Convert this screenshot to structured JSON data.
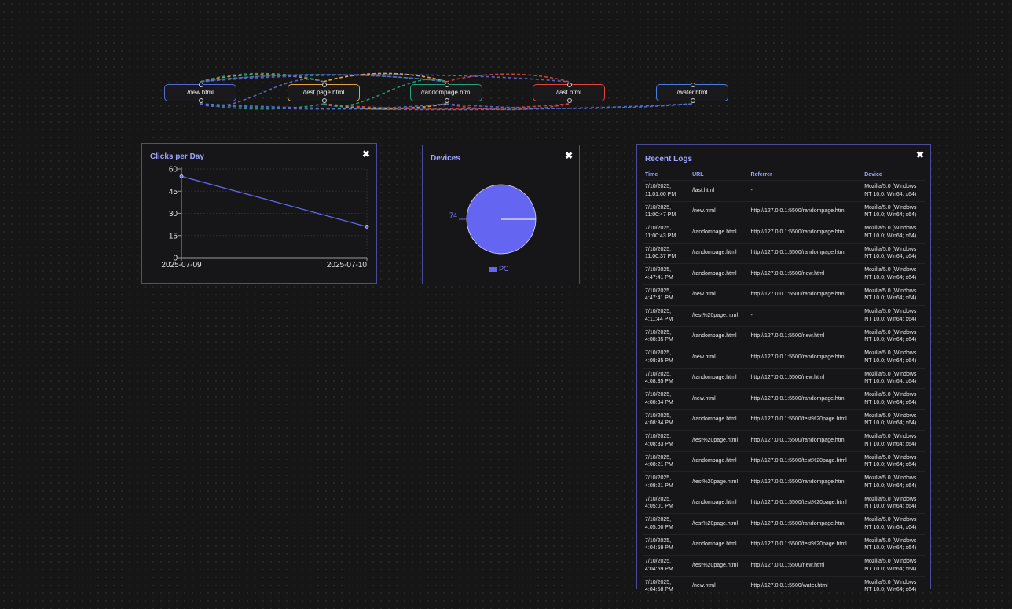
{
  "nodes": [
    {
      "label": "/new.html",
      "border": "#5a6ad6"
    },
    {
      "label": "/test page.html",
      "border": "#e0a345"
    },
    {
      "label": "/randompage.html",
      "border": "#27a07a"
    },
    {
      "label": "/last.html",
      "border": "#e0463d"
    },
    {
      "label": "/water.html",
      "border": "#4a7ee0"
    }
  ],
  "clicks_panel": {
    "title": "Clicks per Day",
    "close": "✖"
  },
  "devices_panel": {
    "title": "Devices",
    "close": "✖",
    "legend": "PC"
  },
  "logs_panel": {
    "title": "Recent Logs",
    "close": "✖",
    "headers": [
      "Time",
      "URL",
      "Referrer",
      "Device"
    ],
    "rows": [
      {
        "time": "7/10/2025, 11:01:00 PM",
        "url": "/last.html",
        "referrer": "-",
        "device": "Mozilla/5.0 (Windows NT 10.0; Win64; x64)"
      },
      {
        "time": "7/10/2025, 11:00:47 PM",
        "url": "/new.html",
        "referrer": "http://127.0.0.1:5500/randompage.html",
        "device": "Mozilla/5.0 (Windows NT 10.0; Win64; x64)"
      },
      {
        "time": "7/10/2025, 11:00:43 PM",
        "url": "/randompage.html",
        "referrer": "http://127.0.0.1:5500/randompage.html",
        "device": "Mozilla/5.0 (Windows NT 10.0; Win64; x64)"
      },
      {
        "time": "7/10/2025, 11:00:37 PM",
        "url": "/randompage.html",
        "referrer": "http://127.0.0.1:5500/randompage.html",
        "device": "Mozilla/5.0 (Windows NT 10.0; Win64; x64)"
      },
      {
        "time": "7/10/2025, 4:47:41 PM",
        "url": "/randompage.html",
        "referrer": "http://127.0.0.1:5500/new.html",
        "device": "Mozilla/5.0 (Windows NT 10.0; Win64; x64)"
      },
      {
        "time": "7/10/2025, 4:47:41 PM",
        "url": "/new.html",
        "referrer": "http://127.0.0.1:5500/randompage.html",
        "device": "Mozilla/5.0 (Windows NT 10.0; Win64; x64)"
      },
      {
        "time": "7/10/2025, 4:11:44 PM",
        "url": "/test%20page.html",
        "referrer": "-",
        "device": "Mozilla/5.0 (Windows NT 10.0; Win64; x64)"
      },
      {
        "time": "7/10/2025, 4:08:35 PM",
        "url": "/randompage.html",
        "referrer": "http://127.0.0.1:5500/new.html",
        "device": "Mozilla/5.0 (Windows NT 10.0; Win64; x64)"
      },
      {
        "time": "7/10/2025, 4:08:35 PM",
        "url": "/new.html",
        "referrer": "http://127.0.0.1:5500/randompage.html",
        "device": "Mozilla/5.0 (Windows NT 10.0; Win64; x64)"
      },
      {
        "time": "7/10/2025, 4:08:35 PM",
        "url": "/randompage.html",
        "referrer": "http://127.0.0.1:5500/new.html",
        "device": "Mozilla/5.0 (Windows NT 10.0; Win64; x64)"
      },
      {
        "time": "7/10/2025, 4:08:34 PM",
        "url": "/new.html",
        "referrer": "http://127.0.0.1:5500/randompage.html",
        "device": "Mozilla/5.0 (Windows NT 10.0; Win64; x64)"
      },
      {
        "time": "7/10/2025, 4:08:34 PM",
        "url": "/randompage.html",
        "referrer": "http://127.0.0.1:5500/test%20page.html",
        "device": "Mozilla/5.0 (Windows NT 10.0; Win64; x64)"
      },
      {
        "time": "7/10/2025, 4:08:33 PM",
        "url": "/test%20page.html",
        "referrer": "http://127.0.0.1:5500/randompage.html",
        "device": "Mozilla/5.0 (Windows NT 10.0; Win64; x64)"
      },
      {
        "time": "7/10/2025, 4:08:21 PM",
        "url": "/randompage.html",
        "referrer": "http://127.0.0.1:5500/test%20page.html",
        "device": "Mozilla/5.0 (Windows NT 10.0; Win64; x64)"
      },
      {
        "time": "7/10/2025, 4:08:21 PM",
        "url": "/test%20page.html",
        "referrer": "http://127.0.0.1:5500/randompage.html",
        "device": "Mozilla/5.0 (Windows NT 10.0; Win64; x64)"
      },
      {
        "time": "7/10/2025, 4:05:01 PM",
        "url": "/randompage.html",
        "referrer": "http://127.0.0.1:5500/test%20page.html",
        "device": "Mozilla/5.0 (Windows NT 10.0; Win64; x64)"
      },
      {
        "time": "7/10/2025, 4:05:00 PM",
        "url": "/test%20page.html",
        "referrer": "http://127.0.0.1:5500/randompage.html",
        "device": "Mozilla/5.0 (Windows NT 10.0; Win64; x64)"
      },
      {
        "time": "7/10/2025, 4:04:59 PM",
        "url": "/randompage.html",
        "referrer": "http://127.0.0.1:5500/test%20page.html",
        "device": "Mozilla/5.0 (Windows NT 10.0; Win64; x64)"
      },
      {
        "time": "7/10/2025, 4:04:59 PM",
        "url": "/test%20page.html",
        "referrer": "http://127.0.0.1:5500/new.html",
        "device": "Mozilla/5.0 (Windows NT 10.0; Win64; x64)"
      },
      {
        "time": "7/10/2025, 4:04:58 PM",
        "url": "/new.html",
        "referrer": "http://127.0.0.1:5500/water.html",
        "device": "Mozilla/5.0 (Windows NT 10.0; Win64; x64)"
      }
    ]
  },
  "chart_data": [
    {
      "type": "line",
      "categories": [
        "2025-07-09",
        "2025-07-10"
      ],
      "values": [
        55,
        21
      ],
      "yticks": [
        0,
        15,
        30,
        45,
        60
      ],
      "ylim": [
        0,
        60
      ],
      "title": "",
      "xlabel": "",
      "ylabel": "",
      "color": "#6466f1"
    },
    {
      "type": "pie",
      "labels": [
        "PC"
      ],
      "values": [
        74
      ],
      "data_label": "74",
      "colors": [
        "#6466f1"
      ]
    }
  ]
}
